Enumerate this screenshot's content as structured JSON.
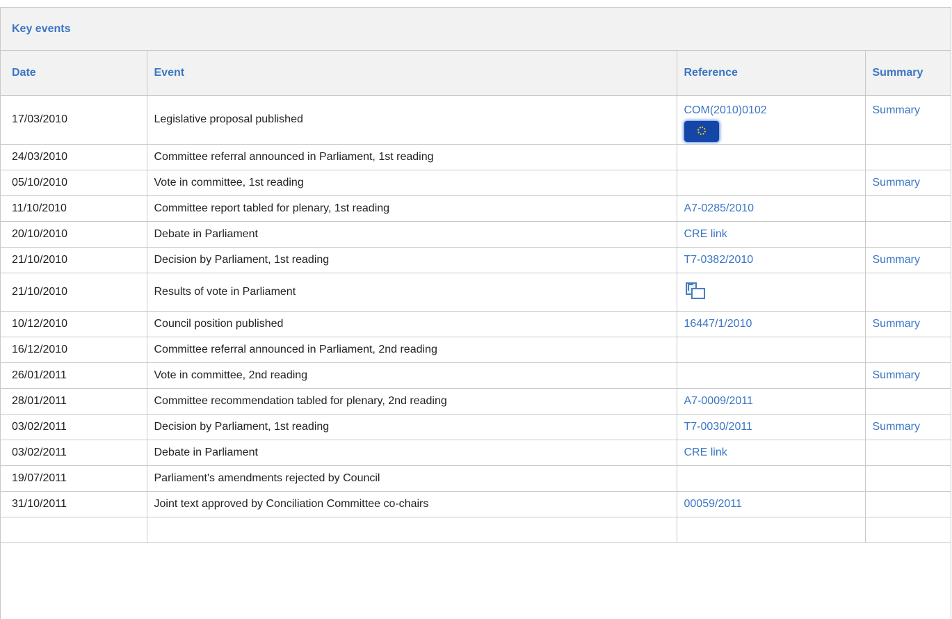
{
  "panel": {
    "title": "Key events"
  },
  "table": {
    "headers": {
      "date": "Date",
      "event": "Event",
      "reference": "Reference",
      "summary": "Summary"
    },
    "rows": [
      {
        "date": "17/03/2010",
        "event": "Legislative proposal published",
        "reference": "COM(2010)0102",
        "summary": "Summary"
      },
      {
        "date": "24/03/2010",
        "event": "Committee referral announced in Parliament, 1st reading",
        "reference": "",
        "summary": ""
      },
      {
        "date": "05/10/2010",
        "event": "Vote in committee, 1st reading",
        "reference": "",
        "summary": "Summary"
      },
      {
        "date": "11/10/2010",
        "event": "Committee report tabled for plenary, 1st reading",
        "reference": "A7-0285/2010",
        "summary": ""
      },
      {
        "date": "20/10/2010",
        "event": "Debate in Parliament",
        "reference": "CRE link",
        "summary": ""
      },
      {
        "date": "21/10/2010",
        "event": "Decision by Parliament, 1st reading",
        "reference": "T7-0382/2010",
        "summary": "Summary"
      },
      {
        "date": "21/10/2010",
        "event": "Results of vote in Parliament",
        "reference": "",
        "summary": ""
      },
      {
        "date": "10/12/2010",
        "event": "Council position published",
        "reference": "16447/1/2010",
        "summary": "Summary"
      },
      {
        "date": "16/12/2010",
        "event": "Committee referral announced in Parliament, 2nd reading",
        "reference": "",
        "summary": ""
      },
      {
        "date": "26/01/2011",
        "event": "Vote in committee, 2nd reading",
        "reference": "",
        "summary": "Summary"
      },
      {
        "date": "28/01/2011",
        "event": "Committee recommendation tabled for plenary, 2nd reading",
        "reference": "A7-0009/2011",
        "summary": ""
      },
      {
        "date": "03/02/2011",
        "event": "Decision by Parliament, 1st reading",
        "reference": "T7-0030/2011",
        "summary": "Summary"
      },
      {
        "date": "03/02/2011",
        "event": "Debate in Parliament",
        "reference": "CRE link",
        "summary": ""
      },
      {
        "date": "19/07/2011",
        "event": "Parliament's amendments rejected by Council",
        "reference": "",
        "summary": ""
      },
      {
        "date": "31/10/2011",
        "event": "Joint text approved by Conciliation Committee co-chairs",
        "reference": "00059/2011",
        "summary": ""
      },
      {
        "date": "",
        "event": "",
        "reference": "",
        "summary": ""
      }
    ]
  },
  "icons": {
    "commission": "european-commission-flag-icon",
    "vote": "vote-results-icon"
  },
  "colors": {
    "link": "#3a75c4",
    "header_bg": "#f2f2f2",
    "border": "#c8c8c8"
  }
}
